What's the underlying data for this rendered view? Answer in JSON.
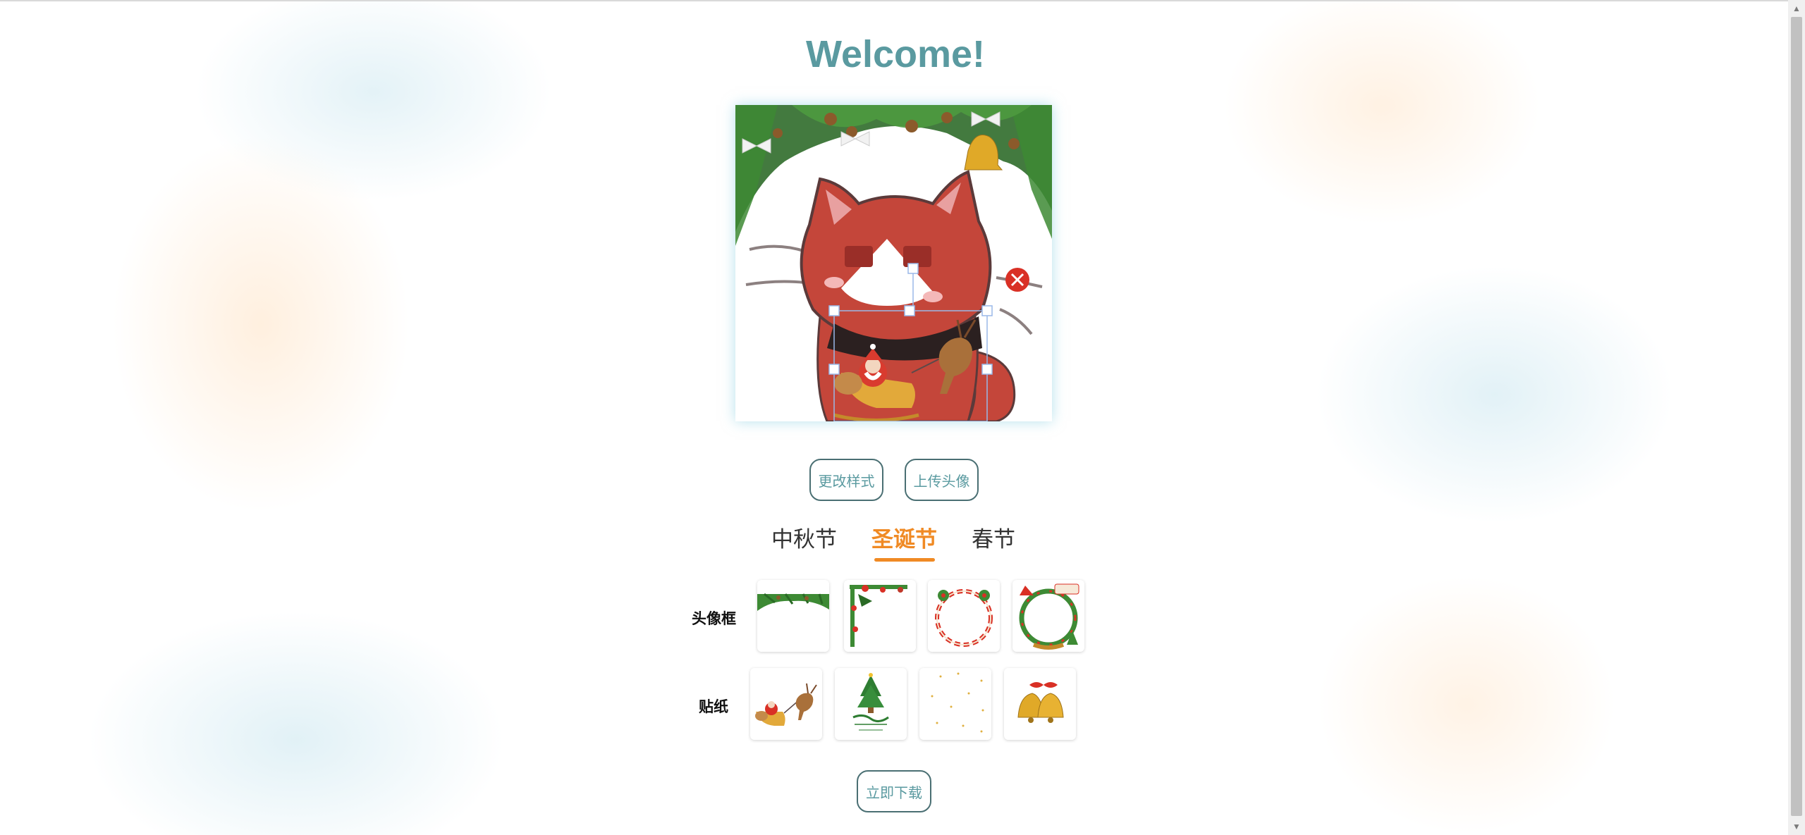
{
  "header": {
    "title": "Welcome!"
  },
  "actions": {
    "change_style": "更改样式",
    "upload_avatar": "上传头像",
    "download_now": "立即下载"
  },
  "tabs": [
    {
      "label": "中秋节",
      "active": false
    },
    {
      "label": "圣诞节",
      "active": true
    },
    {
      "label": "春节",
      "active": false
    }
  ],
  "sections": {
    "frames": {
      "label": "头像框",
      "items": [
        "pine-garland-frame-icon",
        "holly-corner-frame-icon",
        "candy-wreath-frame-icon",
        "merry-christmas-wreath-icon"
      ]
    },
    "stickers": {
      "label": "贴纸",
      "items": [
        "santa-sleigh-icon",
        "merry-christmas-tree-icon",
        "snowflake-dots-icon",
        "bells-icon"
      ]
    }
  },
  "colors": {
    "accent": "#f08a24",
    "title": "#5a9aa0",
    "button_border": "#4a6f73",
    "delete_badge": "#d93025"
  }
}
